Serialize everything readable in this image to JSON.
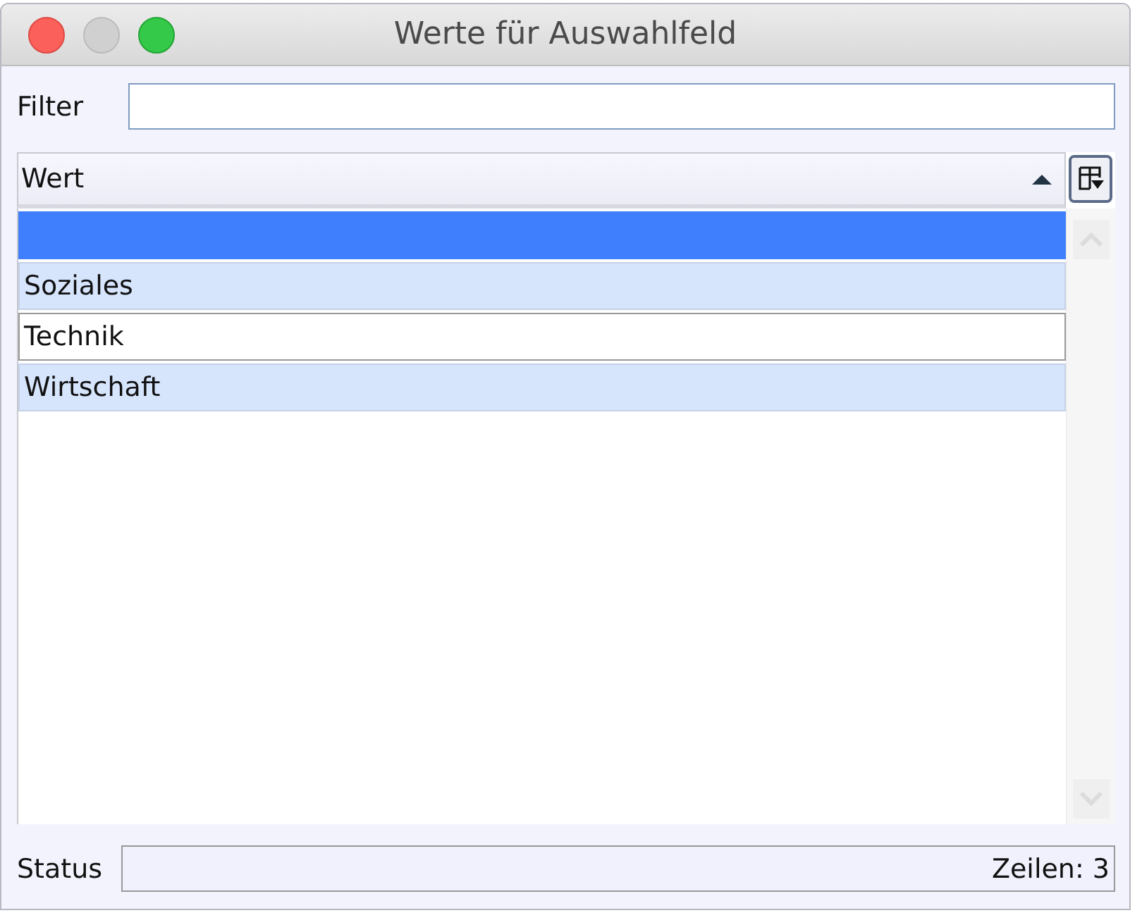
{
  "window": {
    "title": "Werte für Auswahlfeld"
  },
  "filter": {
    "label": "Filter"
  },
  "table": {
    "columns": [
      {
        "label": "Wert",
        "sort_ascending": true
      }
    ],
    "rows": [
      {
        "selected": true,
        "focused": false
      },
      {
        "label": "Soziales",
        "selected": false,
        "focused": false
      },
      {
        "label": "Technik",
        "selected": false,
        "focused": true
      },
      {
        "label": "Wirtschaft",
        "selected": false,
        "focused": false
      }
    ]
  },
  "status_bar": {
    "label": "Status",
    "text": "Zeilen: 3"
  }
}
